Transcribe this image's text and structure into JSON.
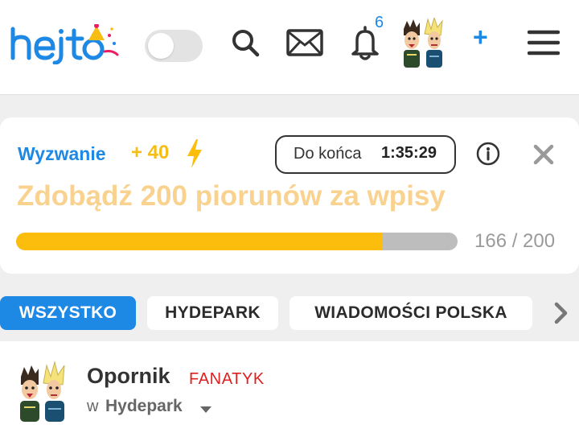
{
  "header": {
    "logo_text": "hejto",
    "dark_mode_toggle": {
      "state": "off"
    },
    "notifications_count": "6",
    "add_label": "+",
    "icons": [
      "search-icon",
      "mail-icon",
      "bell-icon",
      "menu-icon"
    ],
    "accent_color": "#1e88e5"
  },
  "challenge": {
    "label": "Wyzwanie",
    "points": "+ 40",
    "countdown_label": "Do końca",
    "countdown_value": "1:35:29",
    "title": "Zdobądź 200 piorunów za wpisy",
    "progress_current": 166,
    "progress_total": 200,
    "progress_text": "166 / 200",
    "colors": {
      "points": "#f6bd13",
      "title": "#f8d28e",
      "bar_fill": "#fcbd0c",
      "bar_track": "#bdbdbd"
    }
  },
  "tabs": [
    {
      "label": "WSZYSTKO",
      "active": true
    },
    {
      "label": "HYDEPARK",
      "active": false
    },
    {
      "label": "WIADOMOŚCI POLSKA",
      "active": false
    }
  ],
  "post": {
    "author": "Opornik",
    "rank": "FANATYK",
    "community_prefix": "w",
    "community": "Hydepark"
  }
}
